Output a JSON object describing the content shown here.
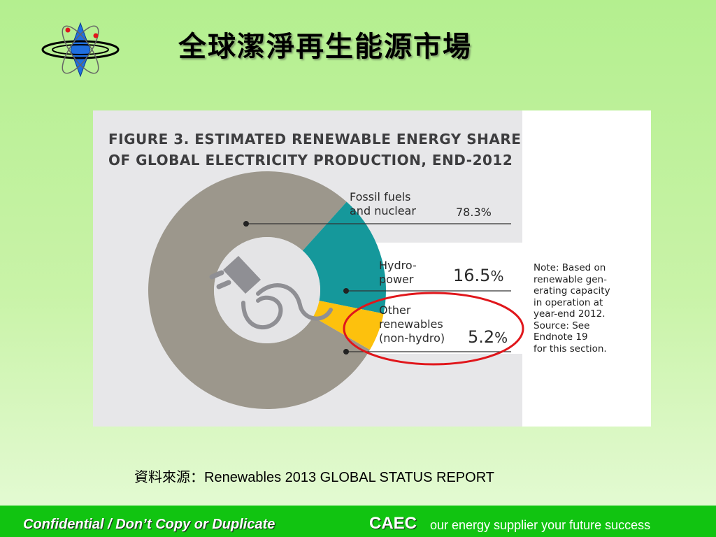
{
  "slide": {
    "title": "全球潔淨再生能源市場",
    "source_text": "資料來源：Renewables 2013 GLOBAL STATUS REPORT"
  },
  "figure": {
    "title_line1": "FIGURE 3. ESTIMATED RENEWABLE ENERGY SHARE",
    "title_line2": "OF GLOBAL ELECTRICITY PRODUCTION, END-2012",
    "note_lines": [
      "Note: Based on",
      "renewable gen-",
      "erating capacity",
      "in operation at",
      "year-end 2012.",
      "Source: See",
      "Endnote 19",
      "for this section."
    ],
    "center_icon": "electric-plug-icon",
    "highlight_color": "#e0161b"
  },
  "chart_data": {
    "type": "pie",
    "donut": true,
    "title": "FIGURE 3. ESTIMATED RENEWABLE ENERGY SHARE OF GLOBAL ELECTRICITY PRODUCTION, END-2012",
    "labels": [
      "Fossil fuels and nuclear",
      "Hydropower",
      "Other renewables (non-hydro)"
    ],
    "values": [
      78.3,
      16.5,
      5.2
    ],
    "unit": "%",
    "colors": [
      "#9c978c",
      "#15989b",
      "#fdc10d"
    ],
    "series_labels": [
      {
        "lines": [
          "Fossil fuels",
          "and nuclear"
        ],
        "value_text": "78.3%"
      },
      {
        "lines": [
          "Hydro-",
          "power"
        ],
        "value_text": "16.5",
        "suffix": "%"
      },
      {
        "lines": [
          "Other",
          "renewables",
          "(non-hydro)"
        ],
        "value_text": "5.2",
        "suffix": "%"
      }
    ]
  },
  "footer": {
    "confidential": "Confidential / Don’t Copy or Duplicate",
    "brand": "CAEC",
    "tagline": "our energy supplier your future success",
    "background": "#11c411"
  }
}
